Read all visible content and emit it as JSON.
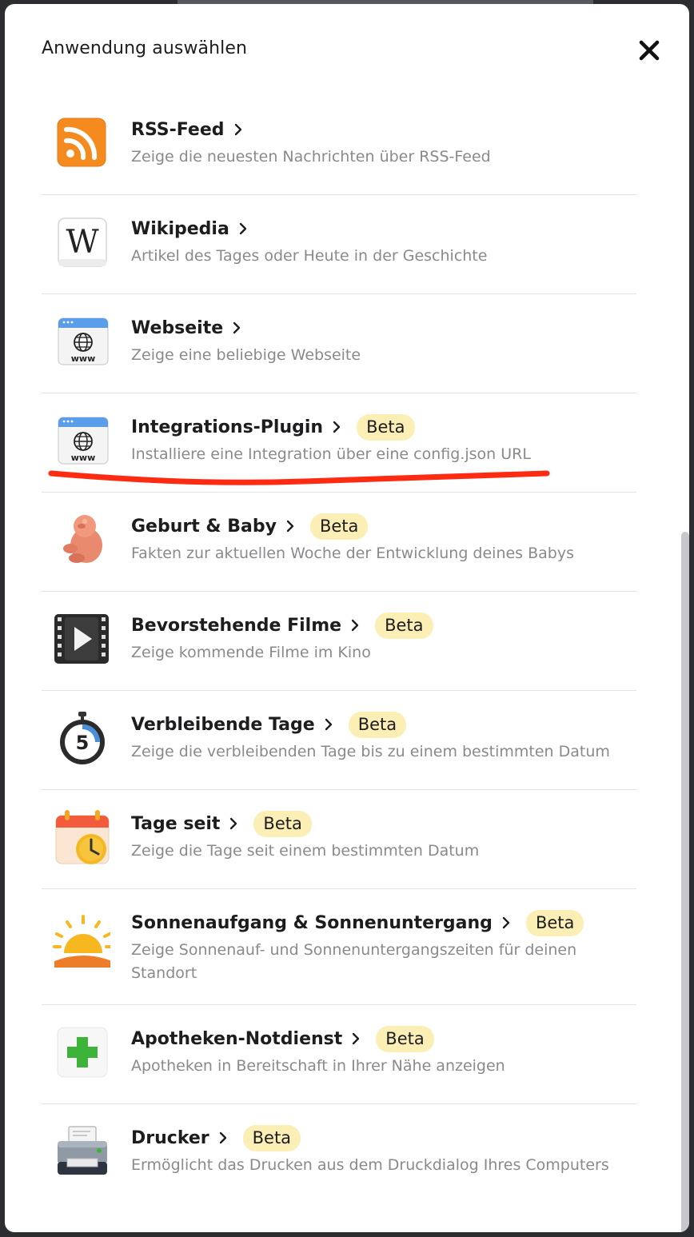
{
  "modal": {
    "title": "Anwendung auswählen",
    "close_icon": "close-icon"
  },
  "colors": {
    "badge_bg": "#fbefb5",
    "highlight_line": "#ff2a12",
    "rss_orange": "#f58a1f",
    "plus_green": "#3db33a"
  },
  "apps": [
    {
      "title": "RSS-Feed",
      "desc": "Zeige die neuesten Nachrichten über RSS-Feed",
      "badge": "",
      "icon": "rss-icon"
    },
    {
      "title": "Wikipedia",
      "desc": "Artikel des Tages oder Heute in der Geschichte",
      "badge": "",
      "icon": "wikipedia-icon"
    },
    {
      "title": "Webseite",
      "desc": "Zeige eine beliebige Webseite",
      "badge": "",
      "icon": "website-icon"
    },
    {
      "title": "Integrations-Plugin",
      "desc": "Installiere eine Integration über eine config.json URL",
      "badge": "Beta",
      "icon": "integration-website-icon"
    },
    {
      "title": "Geburt & Baby",
      "desc": "Fakten zur aktuellen Woche der Entwicklung deines Babys",
      "badge": "Beta",
      "icon": "fetus-icon"
    },
    {
      "title": "Bevorstehende Filme",
      "desc": "Zeige kommende Filme im Kino",
      "badge": "Beta",
      "icon": "film-play-icon"
    },
    {
      "title": "Verbleibende Tage",
      "desc": "Zeige die verbleibenden Tage bis zu einem bestimmten Datum",
      "badge": "Beta",
      "icon": "stopwatch-icon",
      "icon_number": "5"
    },
    {
      "title": "Tage seit",
      "desc": "Zeige die Tage seit einem bestimmten Datum",
      "badge": "Beta",
      "icon": "calendar-clock-icon"
    },
    {
      "title": "Sonnenaufgang & Sonnenuntergang",
      "desc": "Zeige Sonnenauf- und Sonnenuntergangszeiten für deinen Standort",
      "badge": "Beta",
      "icon": "sunrise-icon"
    },
    {
      "title": "Apotheken-Notdienst",
      "desc": "Apotheken in Bereitschaft in Ihrer Nähe anzeigen",
      "badge": "Beta",
      "icon": "pharmacy-cross-icon"
    },
    {
      "title": "Drucker",
      "desc": "Ermöglicht das Drucken aus dem Druckdialog Ihres Computers",
      "badge": "Beta",
      "icon": "printer-icon"
    }
  ]
}
